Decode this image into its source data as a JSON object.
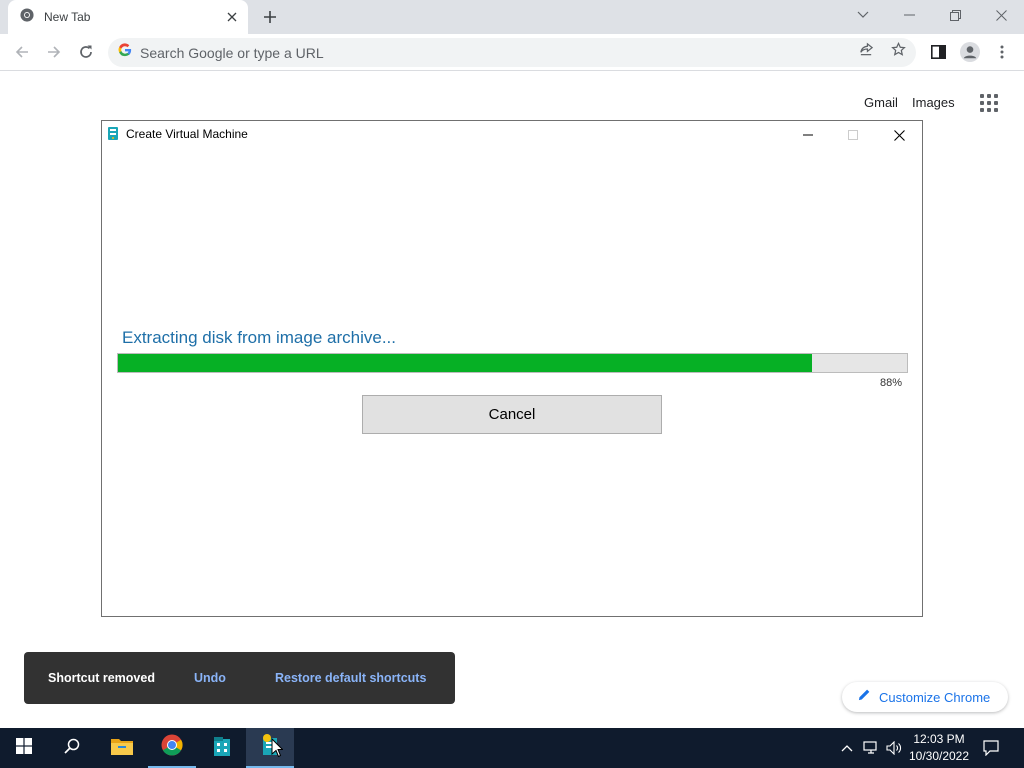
{
  "browser": {
    "tab_title": "New Tab",
    "omnibox_placeholder": "Search Google or type a URL"
  },
  "ntp": {
    "gmail": "Gmail",
    "images": "Images",
    "customize_label": "Customize Chrome"
  },
  "dialog": {
    "title": "Create Virtual Machine",
    "status_text": "Extracting disk from image archive...",
    "progress_percent": 88,
    "progress_label": "88%",
    "cancel_label": "Cancel"
  },
  "snackbar": {
    "message": "Shortcut removed",
    "undo_label": "Undo",
    "restore_label": "Restore default shortcuts"
  },
  "taskbar": {
    "time": "12:03 PM",
    "date": "10/30/2022",
    "pinned": [
      "start-icon",
      "search-icon",
      "file-explorer-icon",
      "chrome-icon",
      "building-app-icon",
      "vm-app-icon"
    ]
  },
  "colors": {
    "progress_fill": "#06b025",
    "status_text": "#1e6fa8",
    "snackbar_bg": "#323232",
    "snackbar_action": "#8ab4f8",
    "taskbar_bg": "#0f1b2d"
  }
}
